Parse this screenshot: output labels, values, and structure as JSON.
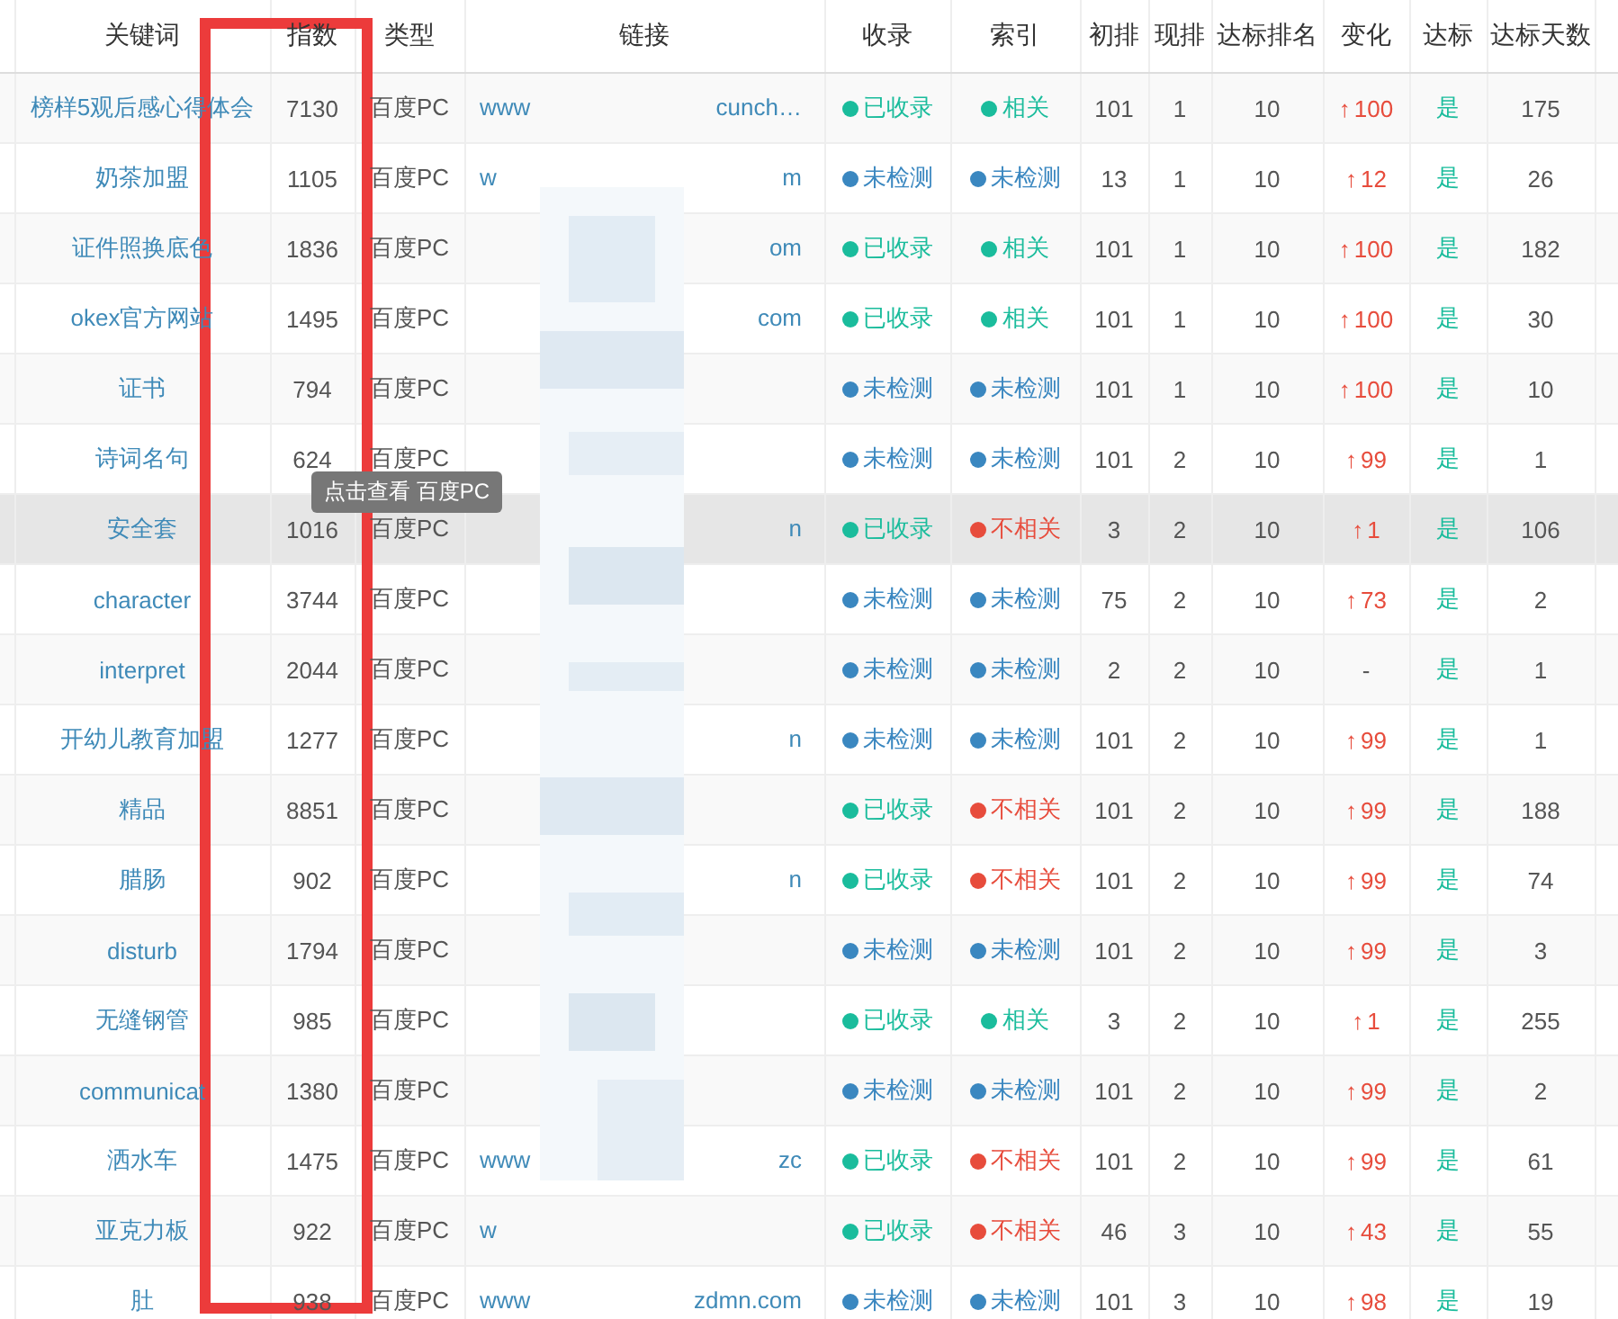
{
  "columns": [
    "关键词",
    "指数",
    "类型",
    "链接",
    "收录",
    "索引",
    "初排",
    "现排",
    "达标排名",
    "变化",
    "达标",
    "达标天数"
  ],
  "rows": [
    {
      "keyword": "榜样5观后感心得体会",
      "index": "7130",
      "type": "百度PC",
      "link_left": "www",
      "link_right": "cunch…",
      "indexed": {
        "text": "已收录",
        "color": "#1abc9c"
      },
      "relevance": {
        "text": "相关",
        "color": "#1abc9c"
      },
      "initial": "101",
      "current": "1",
      "target": "10",
      "change": {
        "arrow": "↑",
        "value": "100"
      },
      "met": "是",
      "days": "175",
      "highlighted": false
    },
    {
      "keyword": "奶茶加盟",
      "index": "1105",
      "type": "百度PC",
      "link_left": "w",
      "link_right": "m",
      "indexed": {
        "text": "未检测",
        "color": "#3a87c0"
      },
      "relevance": {
        "text": "未检测",
        "color": "#3a87c0"
      },
      "initial": "13",
      "current": "1",
      "target": "10",
      "change": {
        "arrow": "↑",
        "value": "12"
      },
      "met": "是",
      "days": "26",
      "highlighted": false
    },
    {
      "keyword": "证件照换底色",
      "index": "1836",
      "type": "百度PC",
      "link_right": "om",
      "indexed": {
        "text": "已收录",
        "color": "#1abc9c"
      },
      "relevance": {
        "text": "相关",
        "color": "#1abc9c"
      },
      "initial": "101",
      "current": "1",
      "target": "10",
      "change": {
        "arrow": "↑",
        "value": "100"
      },
      "met": "是",
      "days": "182",
      "highlighted": false
    },
    {
      "keyword": "okex官方网站",
      "index": "1495",
      "type": "百度PC",
      "link_right": "com",
      "indexed": {
        "text": "已收录",
        "color": "#1abc9c"
      },
      "relevance": {
        "text": "相关",
        "color": "#1abc9c"
      },
      "initial": "101",
      "current": "1",
      "target": "10",
      "change": {
        "arrow": "↑",
        "value": "100"
      },
      "met": "是",
      "days": "30",
      "highlighted": false
    },
    {
      "keyword": "证书",
      "index": "794",
      "type": "百度PC",
      "indexed": {
        "text": "未检测",
        "color": "#3a87c0"
      },
      "relevance": {
        "text": "未检测",
        "color": "#3a87c0"
      },
      "initial": "101",
      "current": "1",
      "target": "10",
      "change": {
        "arrow": "↑",
        "value": "100"
      },
      "met": "是",
      "days": "10",
      "highlighted": false
    },
    {
      "keyword": "诗词名句",
      "index": "624",
      "type": "百度PC",
      "indexed": {
        "text": "未检测",
        "color": "#3a87c0"
      },
      "relevance": {
        "text": "未检测",
        "color": "#3a87c0"
      },
      "initial": "101",
      "current": "2",
      "target": "10",
      "change": {
        "arrow": "↑",
        "value": "99"
      },
      "met": "是",
      "days": "1",
      "highlighted": false
    },
    {
      "keyword": "安全套",
      "index": "1016",
      "type": "百度PC",
      "link_right": "n",
      "indexed": {
        "text": "已收录",
        "color": "#1abc9c"
      },
      "relevance": {
        "text": "不相关",
        "color": "#e74c3c"
      },
      "initial": "3",
      "current": "2",
      "target": "10",
      "change": {
        "arrow": "↑",
        "value": "1"
      },
      "met": "是",
      "days": "106",
      "highlighted": true
    },
    {
      "keyword": "character",
      "index": "3744",
      "type": "百度PC",
      "indexed": {
        "text": "未检测",
        "color": "#3a87c0"
      },
      "relevance": {
        "text": "未检测",
        "color": "#3a87c0"
      },
      "initial": "75",
      "current": "2",
      "target": "10",
      "change": {
        "arrow": "↑",
        "value": "73"
      },
      "met": "是",
      "days": "2",
      "highlighted": false
    },
    {
      "keyword": "interpret",
      "index": "2044",
      "type": "百度PC",
      "indexed": {
        "text": "未检测",
        "color": "#3a87c0"
      },
      "relevance": {
        "text": "未检测",
        "color": "#3a87c0"
      },
      "initial": "2",
      "current": "2",
      "target": "10",
      "change": {
        "value": "-"
      },
      "met": "是",
      "days": "1",
      "highlighted": false
    },
    {
      "keyword": "开幼儿教育加盟",
      "index": "1277",
      "type": "百度PC",
      "link_right": "n",
      "indexed": {
        "text": "未检测",
        "color": "#3a87c0"
      },
      "relevance": {
        "text": "未检测",
        "color": "#3a87c0"
      },
      "initial": "101",
      "current": "2",
      "target": "10",
      "change": {
        "arrow": "↑",
        "value": "99"
      },
      "met": "是",
      "days": "1",
      "highlighted": false
    },
    {
      "keyword": "精品",
      "index": "8851",
      "type": "百度PC",
      "indexed": {
        "text": "已收录",
        "color": "#1abc9c"
      },
      "relevance": {
        "text": "不相关",
        "color": "#e74c3c"
      },
      "initial": "101",
      "current": "2",
      "target": "10",
      "change": {
        "arrow": "↑",
        "value": "99"
      },
      "met": "是",
      "days": "188",
      "highlighted": false
    },
    {
      "keyword": "腊肠",
      "index": "902",
      "type": "百度PC",
      "link_right": "n",
      "indexed": {
        "text": "已收录",
        "color": "#1abc9c"
      },
      "relevance": {
        "text": "不相关",
        "color": "#e74c3c"
      },
      "initial": "101",
      "current": "2",
      "target": "10",
      "change": {
        "arrow": "↑",
        "value": "99"
      },
      "met": "是",
      "days": "74",
      "highlighted": false
    },
    {
      "keyword": "disturb",
      "index": "1794",
      "type": "百度PC",
      "indexed": {
        "text": "未检测",
        "color": "#3a87c0"
      },
      "relevance": {
        "text": "未检测",
        "color": "#3a87c0"
      },
      "initial": "101",
      "current": "2",
      "target": "10",
      "change": {
        "arrow": "↑",
        "value": "99"
      },
      "met": "是",
      "days": "3",
      "highlighted": false
    },
    {
      "keyword": "无缝钢管",
      "index": "985",
      "type": "百度PC",
      "indexed": {
        "text": "已收录",
        "color": "#1abc9c"
      },
      "relevance": {
        "text": "相关",
        "color": "#1abc9c"
      },
      "initial": "3",
      "current": "2",
      "target": "10",
      "change": {
        "arrow": "↑",
        "value": "1"
      },
      "met": "是",
      "days": "255",
      "highlighted": false
    },
    {
      "keyword": "communicat",
      "index": "1380",
      "type": "百度PC",
      "indexed": {
        "text": "未检测",
        "color": "#3a87c0"
      },
      "relevance": {
        "text": "未检测",
        "color": "#3a87c0"
      },
      "initial": "101",
      "current": "2",
      "target": "10",
      "change": {
        "arrow": "↑",
        "value": "99"
      },
      "met": "是",
      "days": "2",
      "highlighted": false
    },
    {
      "keyword": "洒水车",
      "index": "1475",
      "type": "百度PC",
      "link_left": "www",
      "link_right": "zc",
      "indexed": {
        "text": "已收录",
        "color": "#1abc9c"
      },
      "relevance": {
        "text": "不相关",
        "color": "#e74c3c"
      },
      "initial": "101",
      "current": "2",
      "target": "10",
      "change": {
        "arrow": "↑",
        "value": "99"
      },
      "met": "是",
      "days": "61",
      "highlighted": false
    },
    {
      "keyword": "亚克力板",
      "index": "922",
      "type": "百度PC",
      "link_left": "w",
      "indexed": {
        "text": "已收录",
        "color": "#1abc9c"
      },
      "relevance": {
        "text": "不相关",
        "color": "#e74c3c"
      },
      "initial": "46",
      "current": "3",
      "target": "10",
      "change": {
        "arrow": "↑",
        "value": "43"
      },
      "met": "是",
      "days": "55",
      "highlighted": false
    },
    {
      "keyword": "肚",
      "index": "938",
      "type": "百度PC",
      "link_left": "www",
      "link_right": "zdmn.com",
      "indexed": {
        "text": "未检测",
        "color": "#3a87c0"
      },
      "relevance": {
        "text": "未检测",
        "color": "#3a87c0"
      },
      "initial": "101",
      "current": "3",
      "target": "10",
      "change": {
        "arrow": "↑",
        "value": "98"
      },
      "met": "是",
      "days": "19",
      "highlighted": false
    }
  ],
  "tooltip": "点击查看 百度PC"
}
